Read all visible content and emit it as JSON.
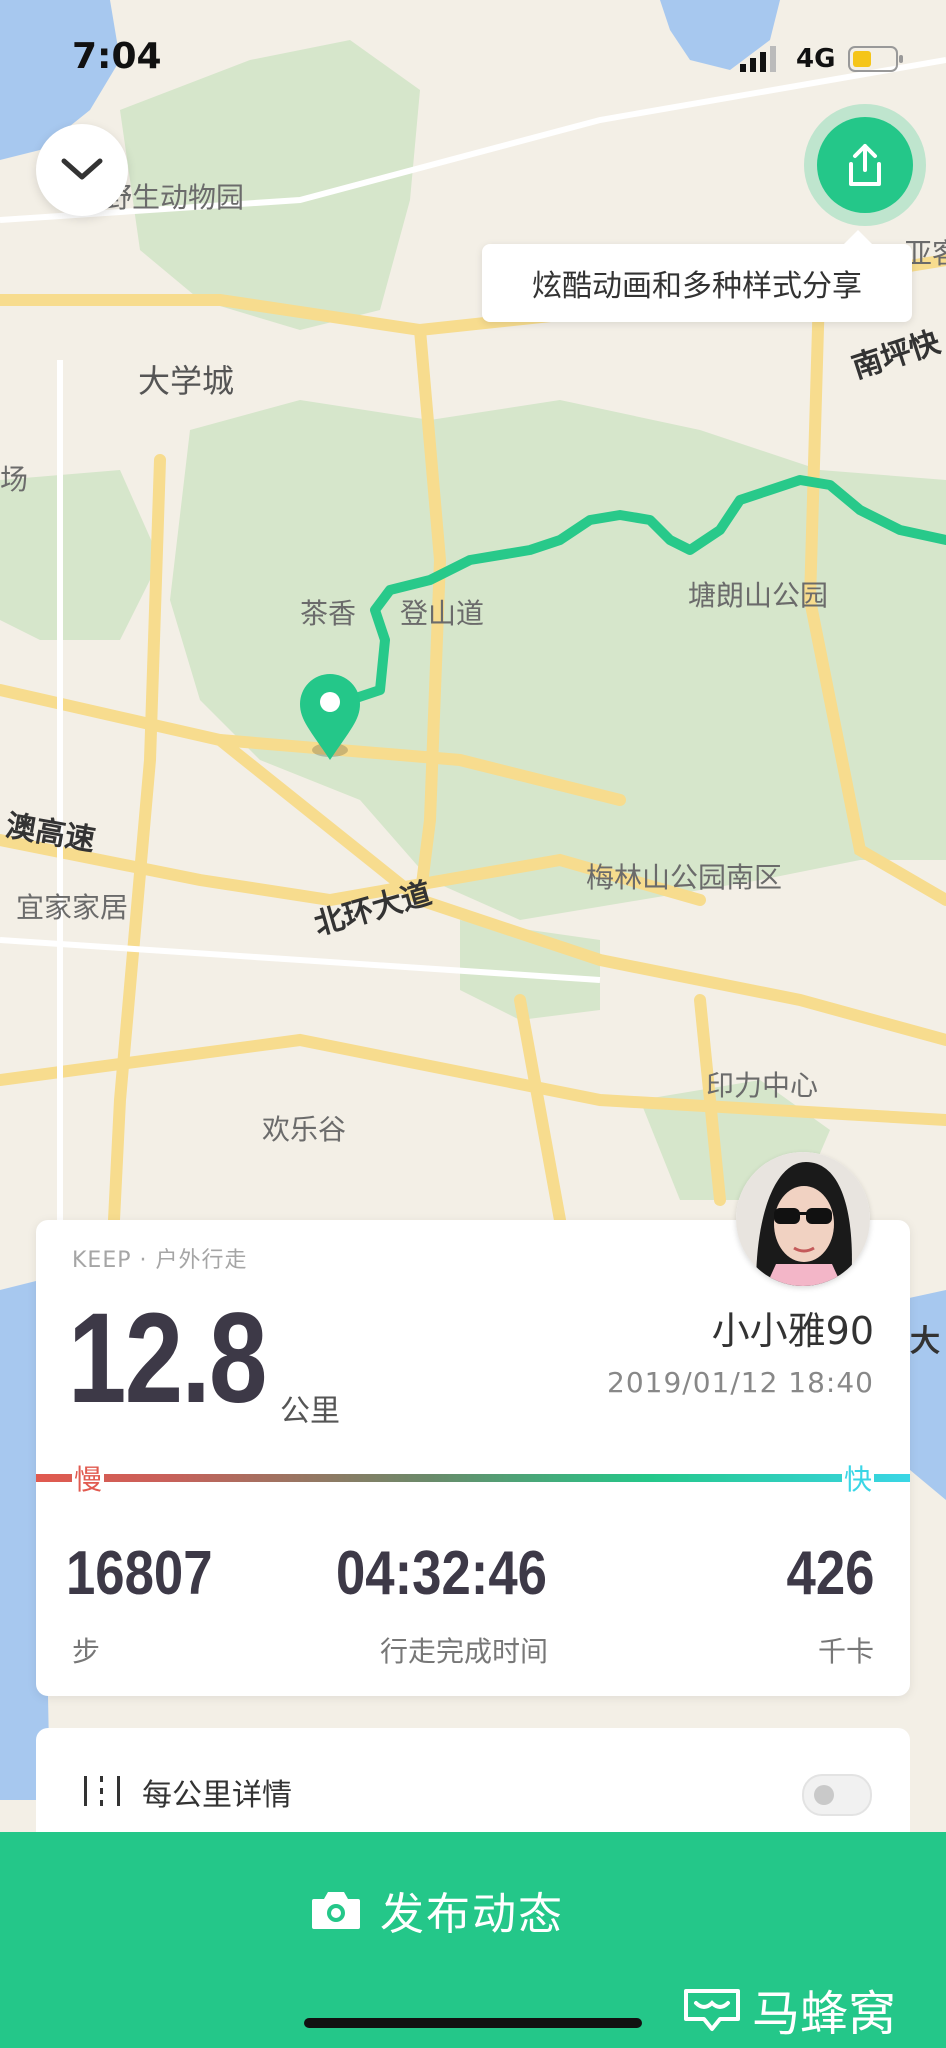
{
  "status_bar": {
    "time": "7:04",
    "network": "4G"
  },
  "share_tooltip": "炫酷动画和多种样式分享",
  "map_labels": {
    "zoo": "野生动物园",
    "daxuecheng": "大学城",
    "nanping": "南坪快",
    "yagu": "亚客",
    "chang": "场",
    "chaxiang": "茶香",
    "dengshan": "登山道",
    "tanglang": "塘朗山公园",
    "aogaosu": "澳高速",
    "yijia": "宜家家居",
    "beihuan": "北环大道",
    "meilin": "梅林山公园南区",
    "yinli": "印力中心",
    "huanlegu": "欢乐谷",
    "da": "大"
  },
  "workout": {
    "source": "KEEP · 户外行走",
    "distance": "12.8",
    "distance_unit": "公里",
    "user_name": "小小雅90",
    "datetime": "2019/01/12 18:40",
    "pace_slow": "慢",
    "pace_fast": "快",
    "steps": "16807",
    "steps_label": "步",
    "duration": "04:32:46",
    "duration_label": "行走完成时间",
    "calories": "426",
    "calories_label": "千卡"
  },
  "detail": {
    "label": "每公里详情"
  },
  "publish": {
    "label": "发布动态"
  },
  "watermark": "马蜂窝",
  "colors": {
    "accent": "#24c789",
    "pace_slow": "#e15a4f",
    "pace_fast": "#3ad6e6",
    "route": "#28c98a"
  }
}
